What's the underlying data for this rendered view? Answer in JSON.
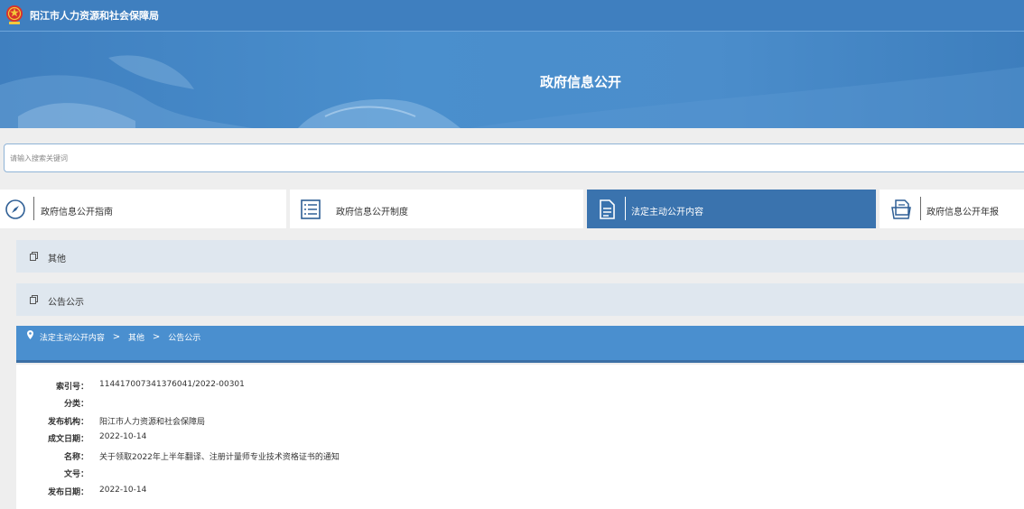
{
  "header": {
    "site_name": "阳江市人力资源和社会保障局"
  },
  "banner": {
    "title": "政府信息公开"
  },
  "search": {
    "placeholder": "请输入搜索关键词",
    "value": ""
  },
  "tabs": [
    {
      "label": "政府信息公开指南",
      "icon": "compass-icon",
      "active": false
    },
    {
      "label": "政府信息公开制度",
      "icon": "list-icon",
      "active": false
    },
    {
      "label": "法定主动公开内容",
      "icon": "document-icon",
      "active": true
    },
    {
      "label": "政府信息公开年报",
      "icon": "report-icon",
      "active": false
    }
  ],
  "categories": [
    {
      "label": "其他",
      "icon": "copy-icon"
    },
    {
      "label": "公告公示",
      "icon": "copy-icon"
    }
  ],
  "breadcrumb": {
    "icon": "location-pin-icon",
    "items": [
      "法定主动公开内容",
      "其他",
      "公告公示"
    ],
    "separator": ">"
  },
  "details": [
    {
      "key": "索引号：",
      "value": "114417007341376041/2022-00301"
    },
    {
      "key": "分类：",
      "value": ""
    },
    {
      "key": "发布机构：",
      "value": "阳江市人力资源和社会保障局"
    },
    {
      "key": "成文日期：",
      "value": "2022-10-14"
    },
    {
      "key": "名称：",
      "value": "关于领取2022年上半年翻译、注册计量师专业技术资格证书的通知"
    },
    {
      "key": "文号：",
      "value": ""
    },
    {
      "key": "发布日期：",
      "value": "2022-10-14"
    }
  ],
  "colors": {
    "header_blue": "#3f7fbf",
    "active_tab": "#3a73ae",
    "breadcrumb_bar": "#4a8fcf",
    "category_bg": "#dfe7ef"
  }
}
